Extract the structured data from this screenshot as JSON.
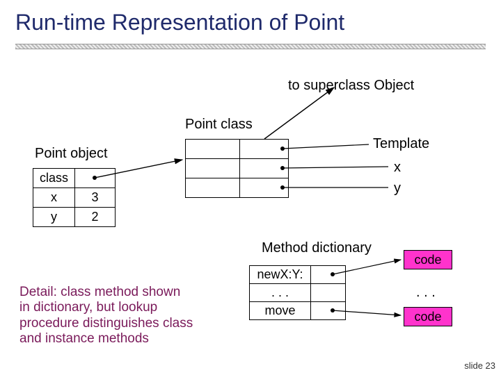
{
  "title": "Run-time Representation of Point",
  "superclass_label": "to superclass Object",
  "point_class_label": "Point class",
  "point_object_label": "Point object",
  "template_label": "Template",
  "method_dict_label": "Method dictionary",
  "detail_text": "Detail: class method shown in dictionary, but lookup procedure distinguishes class and instance methods",
  "code_label": "code",
  "ellipsis": ". . .",
  "slide_number": "slide 23",
  "pobj": {
    "r1": "class",
    "r2_label": "x",
    "r2_val": "3",
    "r3_label": "y",
    "r3_val": "2"
  },
  "template": {
    "r1": "Template",
    "r2": "x",
    "r3": "y"
  },
  "mdict": {
    "r1": "newX:Y:",
    "r2": ". . .",
    "r3": "move"
  }
}
